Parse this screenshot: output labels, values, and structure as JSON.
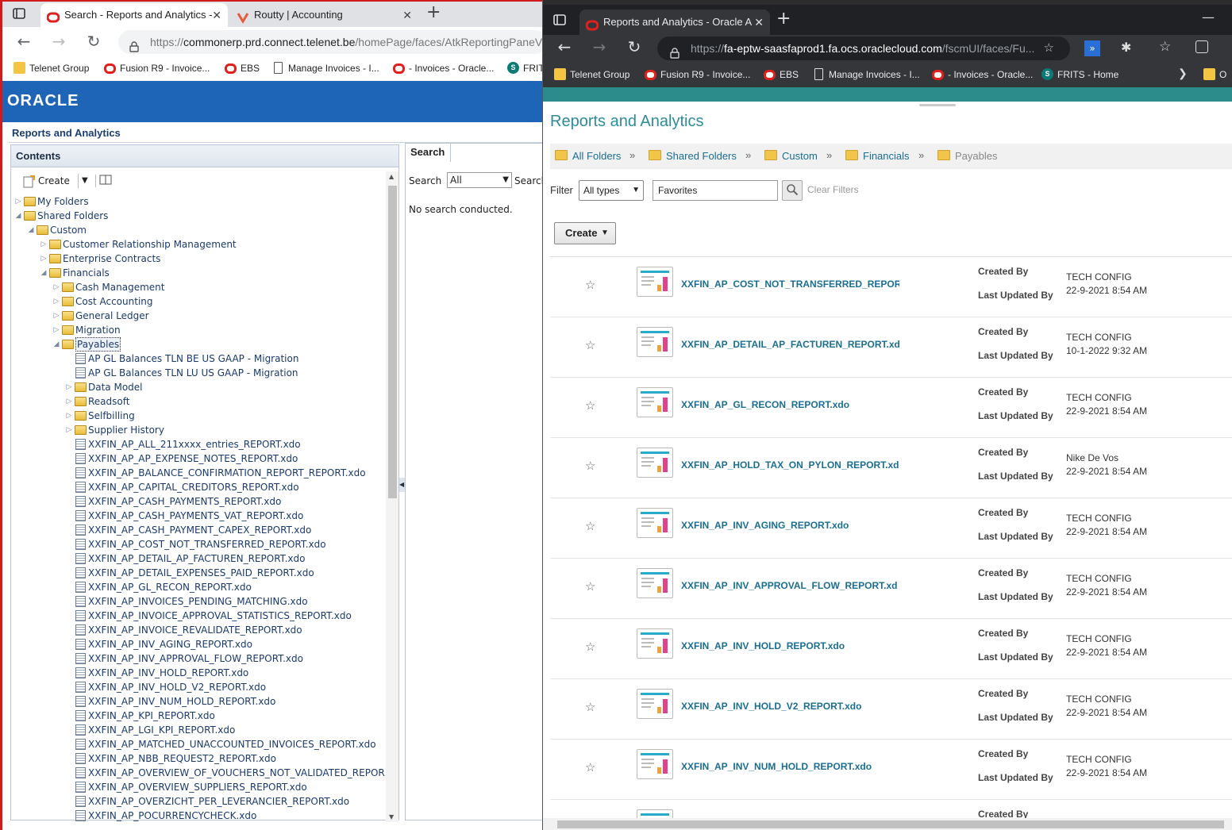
{
  "left_window": {
    "tabs": [
      {
        "title": "Search - Reports and Analytics -",
        "active": true
      },
      {
        "title": "Routty | Accounting",
        "active": false
      }
    ],
    "url": {
      "prefix": "https://",
      "domain": "commonerp.prd.connect.telenet.be",
      "path": "/homePage/faces/AtkReportingPaneV"
    },
    "bookmarks": [
      {
        "label": "Telenet Group",
        "icon": "folder-icon"
      },
      {
        "label": "Fusion R9 - Invoice...",
        "icon": "oracle-icon"
      },
      {
        "label": "EBS",
        "icon": "oracle-icon"
      },
      {
        "label": "Manage Invoices - I...",
        "icon": "page-icon"
      },
      {
        "label": "- Invoices - Oracle...",
        "icon": "oracle-icon"
      },
      {
        "label": "FRIT",
        "icon": "sharepoint-icon"
      }
    ],
    "brand": "ORACLE",
    "page_title": "Reports and Analytics",
    "contents_title": "Contents",
    "create_label": "Create",
    "search_tab": "Search",
    "search_label": "Search",
    "search_scope": "All",
    "search_label2": "Search",
    "no_search": "No search conducted.",
    "tree": [
      {
        "label": "My Folders",
        "level": 0,
        "type": "folder",
        "expanded": false
      },
      {
        "label": "Shared Folders",
        "level": 0,
        "type": "folder",
        "expanded": true
      },
      {
        "label": "Custom",
        "level": 1,
        "type": "folder",
        "expanded": true
      },
      {
        "label": "Customer Relationship Management",
        "level": 2,
        "type": "folder",
        "expanded": false
      },
      {
        "label": "Enterprise Contracts",
        "level": 2,
        "type": "folder",
        "expanded": false
      },
      {
        "label": "Financials",
        "level": 2,
        "type": "folder",
        "expanded": true
      },
      {
        "label": "Cash Management",
        "level": 3,
        "type": "folder",
        "expanded": false
      },
      {
        "label": "Cost Accounting",
        "level": 3,
        "type": "folder",
        "expanded": false
      },
      {
        "label": "General Ledger",
        "level": 3,
        "type": "folder",
        "expanded": false
      },
      {
        "label": "Migration",
        "level": 3,
        "type": "folder",
        "expanded": false
      },
      {
        "label": "Payables",
        "level": 3,
        "type": "folder",
        "expanded": true,
        "selected": true
      },
      {
        "label": "AP GL Balances TLN BE US GAAP - Migration",
        "level": 4,
        "type": "doc"
      },
      {
        "label": "AP GL Balances TLN LU US GAAP - Migration",
        "level": 4,
        "type": "doc"
      },
      {
        "label": "Data Model",
        "level": 4,
        "type": "folder",
        "expanded": false
      },
      {
        "label": "Readsoft",
        "level": 4,
        "type": "folder",
        "expanded": false
      },
      {
        "label": "Selfbilling",
        "level": 4,
        "type": "folder",
        "expanded": false
      },
      {
        "label": "Supplier History",
        "level": 4,
        "type": "folder",
        "expanded": false
      },
      {
        "label": "XXFIN_AP_ALL_211xxxx_entries_REPORT.xdo",
        "level": 4,
        "type": "doc"
      },
      {
        "label": "XXFIN_AP_AP_EXPENSE_NOTES_REPORT.xdo",
        "level": 4,
        "type": "doc"
      },
      {
        "label": "XXFIN_AP_BALANCE_CONFIRMATION_REPORT_REPORT.xdo",
        "level": 4,
        "type": "doc"
      },
      {
        "label": "XXFIN_AP_CAPITAL_CREDITORS_REPORT.xdo",
        "level": 4,
        "type": "doc"
      },
      {
        "label": "XXFIN_AP_CASH_PAYMENTS_REPORT.xdo",
        "level": 4,
        "type": "doc"
      },
      {
        "label": "XXFIN_AP_CASH_PAYMENTS_VAT_REPORT.xdo",
        "level": 4,
        "type": "doc"
      },
      {
        "label": "XXFIN_AP_CASH_PAYMENT_CAPEX_REPORT.xdo",
        "level": 4,
        "type": "doc"
      },
      {
        "label": "XXFIN_AP_COST_NOT_TRANSFERRED_REPORT.xdo",
        "level": 4,
        "type": "doc"
      },
      {
        "label": "XXFIN_AP_DETAIL_AP_FACTUREN_REPORT.xdo",
        "level": 4,
        "type": "doc"
      },
      {
        "label": "XXFIN_AP_DETAIL_EXPENSES_PAID_REPORT.xdo",
        "level": 4,
        "type": "doc"
      },
      {
        "label": "XXFIN_AP_GL_RECON_REPORT.xdo",
        "level": 4,
        "type": "doc"
      },
      {
        "label": "XXFIN_AP_INVOICES_PENDING_MATCHING.xdo",
        "level": 4,
        "type": "doc"
      },
      {
        "label": "XXFIN_AP_INVOICE_APPROVAL_STATISTICS_REPORT.xdo",
        "level": 4,
        "type": "doc"
      },
      {
        "label": "XXFIN_AP_INVOICE_REVALIDATE_REPORT.xdo",
        "level": 4,
        "type": "doc"
      },
      {
        "label": "XXFIN_AP_INV_AGING_REPORT.xdo",
        "level": 4,
        "type": "doc"
      },
      {
        "label": "XXFIN_AP_INV_APPROVAL_FLOW_REPORT.xdo",
        "level": 4,
        "type": "doc"
      },
      {
        "label": "XXFIN_AP_INV_HOLD_REPORT.xdo",
        "level": 4,
        "type": "doc"
      },
      {
        "label": "XXFIN_AP_INV_HOLD_V2_REPORT.xdo",
        "level": 4,
        "type": "doc"
      },
      {
        "label": "XXFIN_AP_INV_NUM_HOLD_REPORT.xdo",
        "level": 4,
        "type": "doc"
      },
      {
        "label": "XXFIN_AP_KPI_REPORT.xdo",
        "level": 4,
        "type": "doc"
      },
      {
        "label": "XXFIN_AP_LGI_KPI_REPORT.xdo",
        "level": 4,
        "type": "doc"
      },
      {
        "label": "XXFIN_AP_MATCHED_UNACCOUNTED_INVOICES_REPORT.xdo",
        "level": 4,
        "type": "doc"
      },
      {
        "label": "XXFIN_AP_NBB_REQUEST2_REPORT.xdo",
        "level": 4,
        "type": "doc"
      },
      {
        "label": "XXFIN_AP_OVERVIEW_OF_VOUCHERS_NOT_VALIDATED_REPOR",
        "level": 4,
        "type": "doc"
      },
      {
        "label": "XXFIN_AP_OVERVIEW_SUPPLIERS_REPORT.xdo",
        "level": 4,
        "type": "doc"
      },
      {
        "label": "XXFIN_AP_OVERZICHT_PER_LEVERANCIER_REPORT.xdo",
        "level": 4,
        "type": "doc"
      },
      {
        "label": "XXFIN_AP_POCURRENCYCHECK.xdo",
        "level": 4,
        "type": "doc"
      }
    ]
  },
  "right_window": {
    "tab_title": "Reports and Analytics - Oracle A",
    "url": {
      "prefix": "https://",
      "domain": "fa-eptw-saasfaprod1.fa.ocs.oraclecloud.com",
      "path": "/fscmUI/faces/Fu..."
    },
    "bookmarks": [
      {
        "label": "Telenet Group",
        "icon": "folder-icon"
      },
      {
        "label": "Fusion R9 - Invoice...",
        "icon": "oracle-icon"
      },
      {
        "label": "EBS",
        "icon": "oracle-icon"
      },
      {
        "label": "Manage Invoices - I...",
        "icon": "page-icon"
      },
      {
        "label": "- Invoices - Oracle...",
        "icon": "oracle-icon"
      },
      {
        "label": "FRITS - Home",
        "icon": "sharepoint-icon"
      },
      {
        "label": "O",
        "icon": "folder-icon"
      }
    ],
    "page_title": "Reports and Analytics",
    "breadcrumbs": [
      "All Folders",
      "Shared Folders",
      "Custom",
      "Financials",
      "Payables"
    ],
    "filter_label": "Filter",
    "type_filter": "All types",
    "search_value": "Favorites",
    "clear_filters": "Clear Filters",
    "create_label": "Create",
    "created_by_label": "Created By",
    "last_updated_label": "Last Updated By",
    "reports": [
      {
        "name": "XXFIN_AP_COST_NOT_TRANSFERRED_REPOR",
        "created_by": "TECH CONFIG",
        "updated": "22-9-2021 8:54 AM"
      },
      {
        "name": "XXFIN_AP_DETAIL_AP_FACTUREN_REPORT.xd",
        "created_by": "TECH CONFIG",
        "updated": "10-1-2022 9:32 AM"
      },
      {
        "name": "XXFIN_AP_GL_RECON_REPORT.xdo",
        "created_by": "TECH CONFIG",
        "updated": "22-9-2021 8:54 AM"
      },
      {
        "name": "XXFIN_AP_HOLD_TAX_ON_PYLON_REPORT.xd",
        "created_by": "Nike De Vos",
        "updated": "22-9-2021 8:54 AM"
      },
      {
        "name": "XXFIN_AP_INV_AGING_REPORT.xdo",
        "created_by": "TECH CONFIG",
        "updated": "22-9-2021 8:54 AM"
      },
      {
        "name": "XXFIN_AP_INV_APPROVAL_FLOW_REPORT.xd",
        "created_by": "TECH CONFIG",
        "updated": "22-9-2021 8:54 AM"
      },
      {
        "name": "XXFIN_AP_INV_HOLD_REPORT.xdo",
        "created_by": "TECH CONFIG",
        "updated": "22-9-2021 8:54 AM"
      },
      {
        "name": "XXFIN_AP_INV_HOLD_V2_REPORT.xdo",
        "created_by": "TECH CONFIG",
        "updated": "22-9-2021 8:54 AM"
      },
      {
        "name": "XXFIN_AP_INV_NUM_HOLD_REPORT.xdo",
        "created_by": "TECH CONFIG",
        "updated": "22-9-2021 8:54 AM"
      }
    ],
    "partial_row_label": "Created By"
  }
}
